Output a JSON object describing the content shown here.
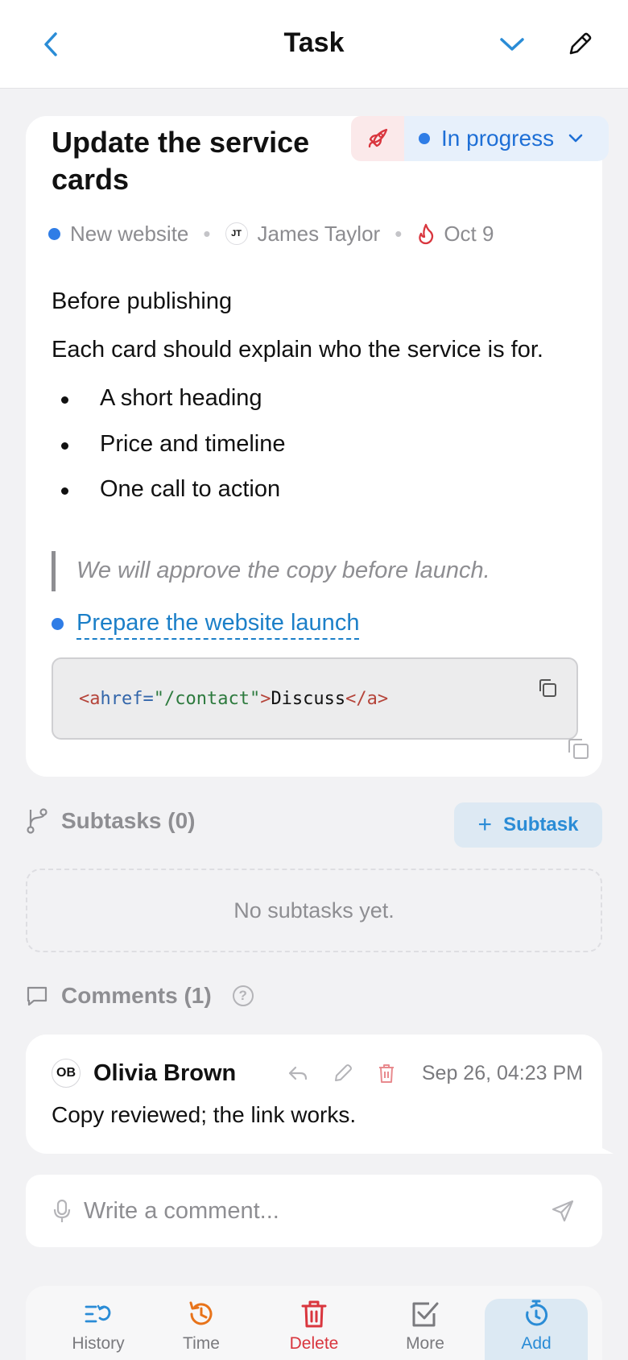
{
  "header": {
    "title": "Task"
  },
  "task": {
    "title": "Update the service cards",
    "status": "In progress",
    "project": "New website",
    "assignee_initials": "JT",
    "assignee": "James Taylor",
    "due": "Oct 9"
  },
  "description": {
    "heading": "Before publishing",
    "paragraph": "Each card should explain who the service is for.",
    "bullets": [
      "A short heading",
      "Price and timeline",
      "One call to action"
    ],
    "quote": "We will approve the copy before launch.",
    "link": "Prepare the website launch",
    "code": {
      "open_tag": "<a",
      "attr": " href=",
      "value": "\"/contact\"",
      "close_bracket": ">",
      "text": "Discuss",
      "end_tag": "</a>"
    }
  },
  "subtasks": {
    "title": "Subtasks (0)",
    "add_label": "Subtask",
    "empty": "No subtasks yet."
  },
  "comments": {
    "title": "Comments (1)",
    "help": "?",
    "items": [
      {
        "initials": "OB",
        "author": "Olivia Brown",
        "time": "Sep 26, 04:23 PM",
        "text": "Copy reviewed; the link works."
      }
    ],
    "composer_placeholder": "Write a comment..."
  },
  "bottom_tabs": [
    {
      "label": "History",
      "color": "#2a8cd6"
    },
    {
      "label": "Time",
      "color": "#e8731a"
    },
    {
      "label": "Delete",
      "color": "#d9363e"
    },
    {
      "label": "More",
      "color": "#7a7a7e"
    },
    {
      "label": "Add",
      "color": "#2a8cd6"
    }
  ],
  "colors": {
    "accent": "#2a8cd6",
    "status_blue": "#2f7de6",
    "danger": "#d9363e"
  }
}
